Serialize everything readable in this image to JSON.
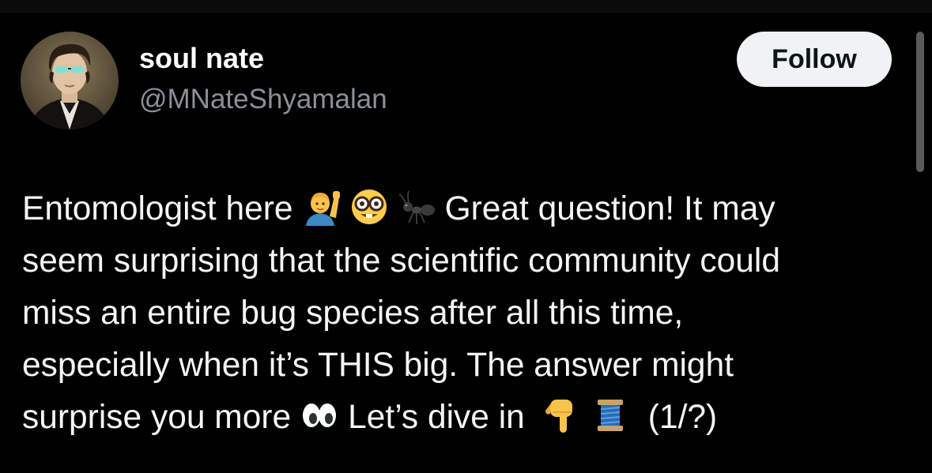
{
  "author": {
    "display_name": "soul nate",
    "handle": "@MNateShyamalan"
  },
  "actions": {
    "follow_label": "Follow"
  },
  "tweet": {
    "line1_a": "Entomologist here",
    "line1_b": "Great question! It may",
    "line2": "seem surprising that the scientific community could",
    "line3": "miss an entire bug species after all this time,",
    "line4": "especially when it’s THIS big. The answer might",
    "line5_a": "surprise you more",
    "line5_b": "Let’s dive in",
    "line5_c": "(1/?)",
    "emojis": [
      "person-raising-hand-icon",
      "nerd-face-icon",
      "ant-icon",
      "eyes-icon",
      "backhand-index-pointing-down-icon",
      "thread-spool-icon"
    ]
  },
  "colors": {
    "background": "#000000",
    "name": "#ffffff",
    "handle": "#8b9097",
    "text": "#f5f5f5",
    "follow_bg": "#eff3f4"
  }
}
